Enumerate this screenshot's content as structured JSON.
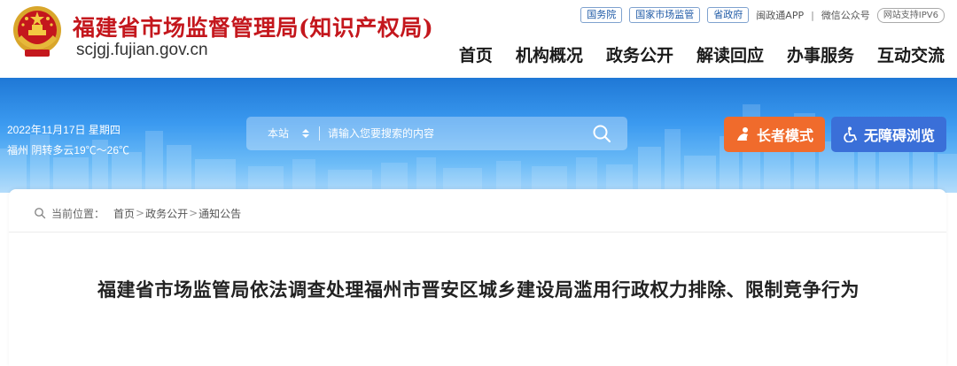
{
  "header": {
    "site_title": "福建省市场监督管理局(知识产权局)",
    "site_domain": "scjgj.fujian.gov.cn",
    "top_links": [
      "国务院",
      "国家市场监管",
      "省政府"
    ],
    "app_link": "闽政通APP",
    "separator": "|",
    "wechat_link": "微信公众号",
    "ipv6_badge": "网站支持IPV6",
    "nav": [
      "首页",
      "机构概况",
      "政务公开",
      "解读回应",
      "办事服务",
      "互动交流"
    ]
  },
  "banner": {
    "date": "2022年11月17日 星期四",
    "weather": "福州 阴转多云19℃～26℃",
    "search": {
      "scope": "本站",
      "placeholder": "请输入您要搜索的内容"
    },
    "elder_mode_label": "长者模式",
    "accessible_label": "无障碍浏览"
  },
  "breadcrumb": {
    "label": "当前位置：",
    "items": [
      "首页",
      "政务公开",
      "通知公告"
    ],
    "separator": ">"
  },
  "article": {
    "title": "福建省市场监管局依法调查处理福州市晋安区城乡建设局滥用行政权力排除、限制竞争行为"
  },
  "colors": {
    "brand_red": "#c4171d",
    "banner_blue": "#2a86e0",
    "elder_orange": "#f06b2c",
    "access_blue": "#3a6fd8"
  },
  "icons": [
    "emblem-icon",
    "chevron-updown-icon",
    "search-icon",
    "elder-icon",
    "wheelchair-icon",
    "location-icon"
  ]
}
